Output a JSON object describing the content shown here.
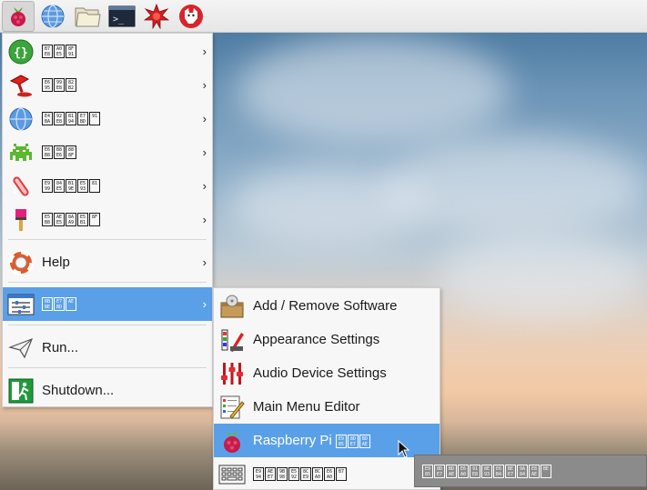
{
  "taskbar": {
    "launchers": [
      {
        "icon": "raspberry-menu-icon",
        "active": true
      },
      {
        "icon": "web-browser-icon"
      },
      {
        "icon": "file-manager-icon"
      },
      {
        "icon": "terminal-icon"
      },
      {
        "icon": "mathematica-icon"
      },
      {
        "icon": "wolfram-icon"
      }
    ]
  },
  "main_menu": {
    "items": [
      {
        "label": "",
        "hex": [
          "B7",
          "E8",
          "A0",
          "E5",
          "8F",
          "91"
        ],
        "icon": "programming-icon",
        "submenu": true
      },
      {
        "label": "",
        "hex": [
          "E6",
          "95",
          "99",
          "E8",
          "82",
          "B2"
        ],
        "icon": "education-icon",
        "submenu": true
      },
      {
        "label": "",
        "hex": [
          "E4",
          "BA",
          "92",
          "E8",
          "81",
          "94",
          "E7",
          "BD",
          "91"
        ],
        "icon": "internet-icon",
        "submenu": true
      },
      {
        "label": "",
        "hex": [
          "E6",
          "B8",
          "B8",
          "E6",
          "88",
          "8F"
        ],
        "icon": "games-icon",
        "submenu": true
      },
      {
        "label": "",
        "hex": [
          "E9",
          "99",
          "84",
          "E5",
          "B1",
          "9E",
          "E5",
          "93",
          "81"
        ],
        "icon": "accessories-icon",
        "submenu": true
      },
      {
        "label": "",
        "hex": [
          "E5",
          "B8",
          "AE",
          "E5",
          "8A",
          "A9",
          "E5",
          "B1",
          "8F"
        ],
        "icon": "universal-access-icon",
        "submenu": true
      },
      {
        "label": "Help",
        "icon": "help-icon",
        "submenu": true
      },
      {
        "label": "",
        "hex": [
          "8B",
          "BE",
          "E7",
          "BD",
          "AE"
        ],
        "icon": "preferences-icon",
        "submenu": true,
        "selected": true
      },
      {
        "label": "Run...",
        "icon": "run-icon",
        "submenu": false
      },
      {
        "label": "Shutdown...",
        "icon": "shutdown-icon",
        "submenu": false
      }
    ]
  },
  "sub_menu": {
    "items": [
      {
        "label": "Add / Remove Software",
        "icon": "package-icon"
      },
      {
        "label": "Appearance Settings",
        "icon": "appearance-icon"
      },
      {
        "label": "Audio Device Settings",
        "icon": "audio-mixer-icon"
      },
      {
        "label": "Main Menu Editor",
        "icon": "menu-editor-icon"
      },
      {
        "label": "Raspberry Pi ",
        "hex": [
          "E9",
          "85",
          "8D",
          "E7",
          "BD",
          "AE"
        ],
        "icon": "raspberry-icon",
        "selected": true
      },
      {
        "label": "",
        "hex": [
          "E9",
          "94",
          "AE",
          "E7",
          "9B",
          "98",
          "E5",
          "92",
          "8C",
          "E9",
          "BC",
          "A0",
          "E6",
          "A0",
          "87"
        ],
        "icon": "keyboard-icon"
      }
    ]
  },
  "tooltip": {
    "hex": [
      "E9",
      "85",
      "8D",
      "E7",
      "BD",
      "AE",
      "E6",
      "A0",
      "91",
      "E8",
      "8E",
      "93",
      "E6",
      "B4",
      "BE",
      "E7",
      "9A",
      "84",
      "E8",
      "AE",
      "BE"
    ]
  },
  "colors": {
    "selection": "#5aa0e8",
    "menu_bg": "#f7f7f7",
    "taskbar_bg": "#ececec"
  }
}
